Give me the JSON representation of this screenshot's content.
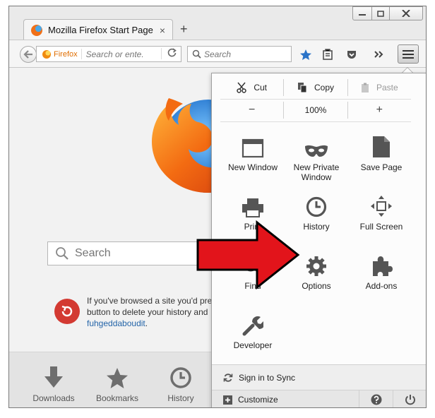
{
  "tab": {
    "title": "Mozilla Firefox Start Page",
    "close": "×",
    "new_tab": "+"
  },
  "navbar": {
    "identity_label": "Firefox",
    "url_placeholder": "Search or ente.",
    "search_placeholder": "Search"
  },
  "page": {
    "search_placeholder": "Search",
    "notice_lines": [
      "If you've browsed a site you'd pre",
      "button to delete your history and"
    ],
    "notice_link": "fuhgeddaboudit",
    "notice_end": ".",
    "launch_items": [
      "Downloads",
      "Bookmarks",
      "History"
    ]
  },
  "menu": {
    "edit": {
      "cut": "Cut",
      "copy": "Copy",
      "paste": "Paste"
    },
    "zoom": {
      "out": "−",
      "level": "100%",
      "in": "+"
    },
    "items": {
      "new_window": "New Window",
      "new_private_window": "New Private Window",
      "save_page": "Save Page",
      "print": "Print",
      "history": "History",
      "full_screen": "Full Screen",
      "find": "Find",
      "options": "Options",
      "addons": "Add-ons",
      "developer": "Developer"
    },
    "sign_in": "Sign in to Sync",
    "customize": "Customize"
  },
  "colors": {
    "arrow_red": "#e2141b",
    "link": "#2364a8",
    "firefox_orange": "#f07018"
  }
}
